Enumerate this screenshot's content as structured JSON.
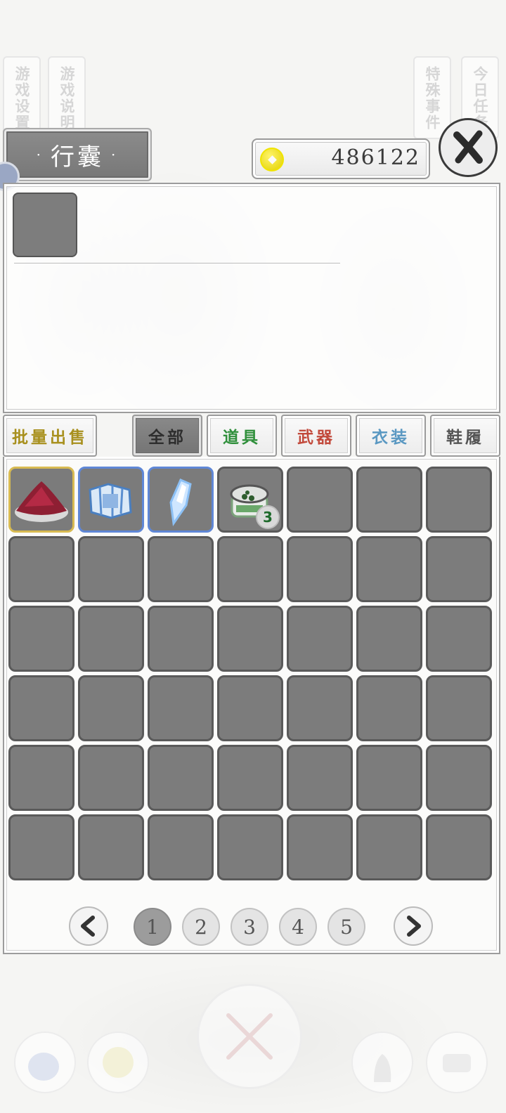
{
  "side_tabs": [
    {
      "label": "游戏设置"
    },
    {
      "label": "游戏说明"
    },
    {
      "label": "特殊事件"
    },
    {
      "label": "今日任务"
    }
  ],
  "header": {
    "title": "行囊",
    "title_decor": "·",
    "currency_value": "486122"
  },
  "tabs": [
    {
      "label": "批量出售",
      "color": "#a8901e"
    },
    {
      "label": "全部",
      "color": "#2e2e2e",
      "active": true
    },
    {
      "label": "道具",
      "color": "#2f8f3b"
    },
    {
      "label": "武器",
      "color": "#c24a3c"
    },
    {
      "label": "衣装",
      "color": "#5a98c2"
    },
    {
      "label": "鞋履",
      "color": "#555555"
    }
  ],
  "inventory": {
    "items": [
      {
        "slot": 1,
        "icon": "red-powder-pile-icon",
        "rarity": "gold"
      },
      {
        "slot": 2,
        "icon": "blue-scroll-map-icon",
        "rarity": "blue"
      },
      {
        "slot": 3,
        "icon": "blue-crystal-shard-icon",
        "rarity": "blue"
      },
      {
        "slot": 4,
        "icon": "jade-pill-box-icon",
        "count": "3"
      }
    ],
    "total_slots": 42
  },
  "pagination": {
    "pages": [
      "1",
      "2",
      "3",
      "4",
      "5"
    ],
    "current": "1"
  }
}
